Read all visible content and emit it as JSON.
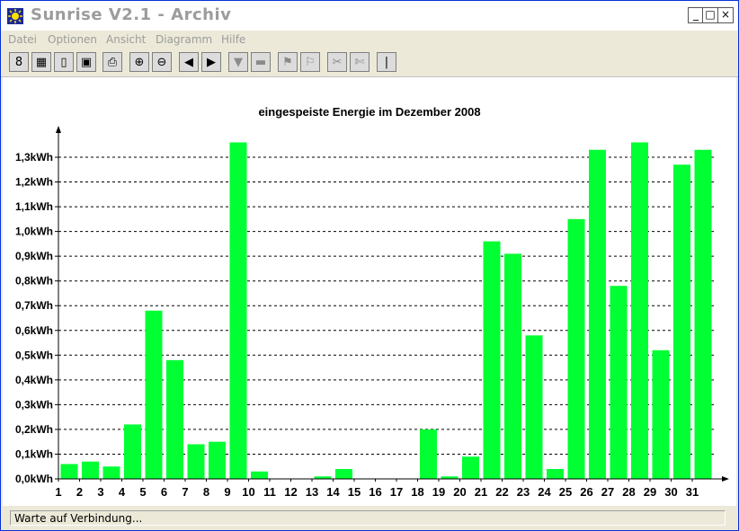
{
  "window": {
    "title": "Sunrise V2.1 - Archiv"
  },
  "menu": [
    "Datei",
    "Optionen",
    "Ansicht",
    "Diagramm",
    "Hilfe"
  ],
  "title_buttons": {
    "minimize": "_",
    "maximize": "□",
    "close": "×"
  },
  "toolbar": [
    {
      "name": "info",
      "icon": "8",
      "enabled": true
    },
    {
      "name": "chart-grid",
      "icon": "▦",
      "enabled": true
    },
    {
      "name": "page",
      "icon": "▯",
      "enabled": true
    },
    {
      "name": "pages",
      "icon": "▣",
      "enabled": true
    },
    {
      "name": "print",
      "icon": "⎙",
      "enabled": true
    },
    {
      "name": "zoom-in",
      "icon": "⊕",
      "enabled": true
    },
    {
      "name": "zoom-out",
      "icon": "⊖",
      "enabled": true
    },
    {
      "name": "prev",
      "icon": "◀",
      "enabled": true
    },
    {
      "name": "next",
      "icon": "▶",
      "enabled": true
    },
    {
      "name": "down-arrow",
      "icon": "▼",
      "enabled": false
    },
    {
      "name": "folder",
      "icon": "▬",
      "enabled": false
    },
    {
      "name": "flag-1",
      "icon": "⚑",
      "enabled": false
    },
    {
      "name": "flag-2",
      "icon": "⚐",
      "enabled": false
    },
    {
      "name": "cut-1",
      "icon": "✂",
      "enabled": false
    },
    {
      "name": "cut-2",
      "icon": "✄",
      "enabled": false
    },
    {
      "name": "thermometer",
      "icon": "|",
      "enabled": true
    }
  ],
  "chart_data": {
    "type": "bar",
    "title": "eingespeiste Energie im Dezember 2008",
    "xlabel": "",
    "ylabel": "",
    "unit": "kWh",
    "color": "#00ff33",
    "ylim": [
      0,
      1.3
    ],
    "yticks": [
      "0,0kWh",
      "0,1kWh",
      "0,2kWh",
      "0,3kWh",
      "0,4kWh",
      "0,5kWh",
      "0,6kWh",
      "0,7kWh",
      "0,8kWh",
      "0,9kWh",
      "1,0kWh",
      "1,1kWh",
      "1,2kWh",
      "1,3kWh"
    ],
    "categories": [
      "1",
      "2",
      "3",
      "4",
      "5",
      "6",
      "7",
      "8",
      "9",
      "10",
      "11",
      "12",
      "13",
      "14",
      "15",
      "16",
      "17",
      "18",
      "19",
      "20",
      "21",
      "22",
      "23",
      "24",
      "25",
      "26",
      "27",
      "28",
      "29",
      "30",
      "31"
    ],
    "values": [
      0.06,
      0.07,
      0.05,
      0.22,
      0.68,
      0.48,
      0.14,
      0.15,
      1.36,
      0.03,
      0.0,
      0.0,
      0.01,
      0.04,
      0.0,
      0.0,
      0.0,
      0.2,
      0.01,
      0.09,
      0.96,
      0.91,
      0.58,
      0.04,
      1.05,
      1.33,
      0.78,
      1.36,
      0.52,
      1.27,
      1.33
    ],
    "grid": true,
    "legend": "none"
  },
  "status": {
    "text": "Warte auf Verbindung..."
  }
}
